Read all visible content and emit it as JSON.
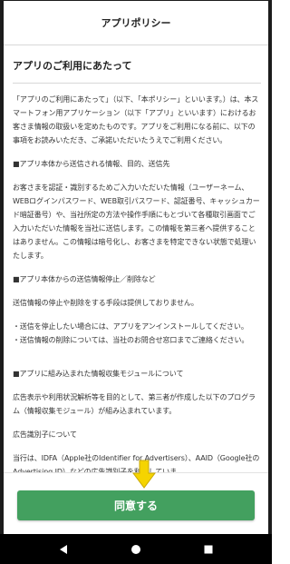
{
  "header": {
    "title": "アプリポリシー"
  },
  "content": {
    "heading": "アプリのご利用にあたって",
    "intro": "「アプリのご利用にあたって」（以下、「本ポリシー」といいます。）は、本スマートフォン用アプリケーション（以下「アプリ」といいます）におけるお客さま情報の取扱いを定めたものです。アプリをご利用になる前に、以下の事項をお読みいただき、ご承諾いただいたうえでご利用ください。",
    "sections": [
      {
        "title": "■アプリ本体から送信される情報、目的、送信先",
        "body": "お客さまを認証・識別するためご入力いただいた情報（ユーザーネーム、WEBログインパスワード、WEB取引パスワード、認証番号、キャッシュカード暗証番号）や、当社所定の方法や操作手順にもとづいて各種取引画面でご入力いただいた情報を当社に送信します。この情報を第三者へ提供することはありません。この情報は暗号化し、お客さまを特定できない状態で処理いたします。"
      },
      {
        "title": "■アプリ本体からの送信情報停止／削除など",
        "body": "送信情報の停止や削除をする手段は提供しておりません。",
        "bullets": [
          "・送信を停止したい場合には、アプリをアンインストールしてください。",
          "・送信情報の削除については、当社のお問合せ窓口までご連絡ください。"
        ]
      },
      {
        "title": "■アプリに組み込まれた情報収集モジュールについて",
        "body": "広告表示や利用状況解析等を目的として、第三者が作成した以下のプログラム（情報収集モジュール）が組み込まれています。",
        "subtitle": "広告識別子について",
        "tail": "当行は、IDFA（Apple社のIdentifier for Advertisers）、AAID（Google社のAdvertising ID）などの広告識別子を利用していま"
      }
    ]
  },
  "footer": {
    "agree_label": "同意する"
  },
  "colors": {
    "accent": "#43a05f",
    "arrow": "#f5d400",
    "navbar": "#000000"
  },
  "icons": {
    "arrow": "arrow-down-icon",
    "back": "back-triangle-icon",
    "home": "home-circle-icon",
    "recents": "recents-square-icon"
  }
}
